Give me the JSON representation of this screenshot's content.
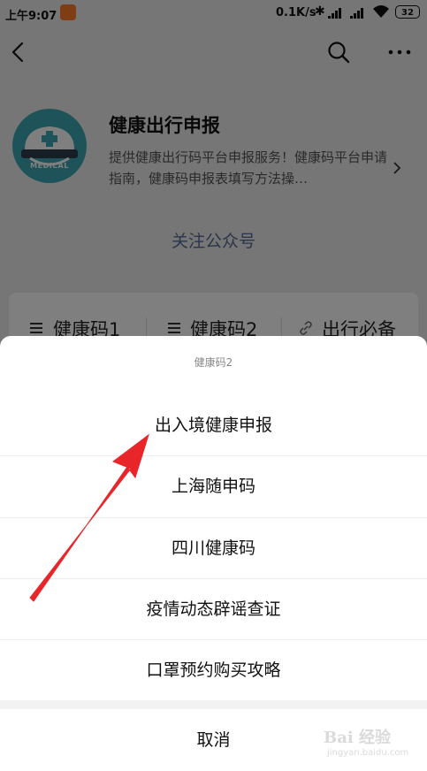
{
  "status_bar": {
    "time": "上午9:07",
    "network_speed": "0.1K/s",
    "battery": "32"
  },
  "account": {
    "name": "健康出行申报",
    "description": "提供健康出行码平台申报服务！健康码平台申请指南，健康码申报表填写方法操…",
    "avatar_text": "MEDICAL",
    "follow_label": "关注公众号"
  },
  "menu_bar": {
    "items": [
      {
        "label": "健康码1",
        "icon": "menu-lines-icon"
      },
      {
        "label": "健康码2",
        "icon": "menu-lines-icon"
      },
      {
        "label": "出行必备",
        "icon": "link-icon"
      }
    ]
  },
  "action_sheet": {
    "title": "健康码2",
    "options": [
      {
        "label": "出入境健康申报"
      },
      {
        "label": "上海随申码"
      },
      {
        "label": "四川健康码"
      },
      {
        "label": "疫情动态辟谣查证"
      },
      {
        "label": "口罩预约购买攻略"
      }
    ],
    "cancel_label": "取消"
  },
  "annotation": {
    "color": "#e8262a",
    "icon": "red-arrow-annotation"
  },
  "watermark": {
    "brand": "Bai 经验",
    "url": "jingyan.baidu.com"
  }
}
